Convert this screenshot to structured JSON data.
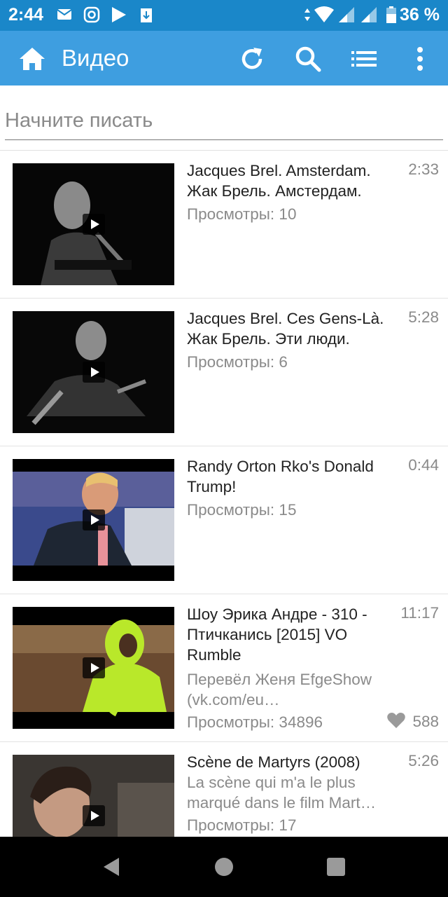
{
  "status_bar": {
    "time": "2:44",
    "battery": "36 %"
  },
  "app_bar": {
    "title": "Видео"
  },
  "search": {
    "placeholder": "Начните писать",
    "value": ""
  },
  "videos": [
    {
      "title": "Jacques Brel. Amsterdam. Жак Брель. Амстердам.",
      "duration": "2:33",
      "description": "",
      "views": "Просмотры: 10",
      "likes": ""
    },
    {
      "title": "Jacques Brel. Ces Gens-Là. Жак Брель. Эти люди.",
      "duration": "5:28",
      "description": "",
      "views": "Просмотры: 6",
      "likes": ""
    },
    {
      "title": "Randy Orton Rko's Donald Trump!",
      "duration": "0:44",
      "description": "",
      "views": "Просмотры: 15",
      "likes": ""
    },
    {
      "title": "Шоу Эрика Андре - 310 - Птичканись [2015] VO Rumble",
      "duration": "11:17",
      "description": "Перевёл Женя EfgeShow (vk.com/eu…",
      "views": "Просмотры: 34896",
      "likes": "588"
    },
    {
      "title": "Scène de Martyrs (2008)",
      "duration": "5:26",
      "description": "La scène qui m'a le plus marqué dans le film Mart…",
      "views": "Просмотры: 17",
      "likes": ""
    }
  ],
  "colors": {
    "status_bar": "#1a87c9",
    "app_bar": "#3e9ee0",
    "secondary_text": "#8a8a8a"
  }
}
